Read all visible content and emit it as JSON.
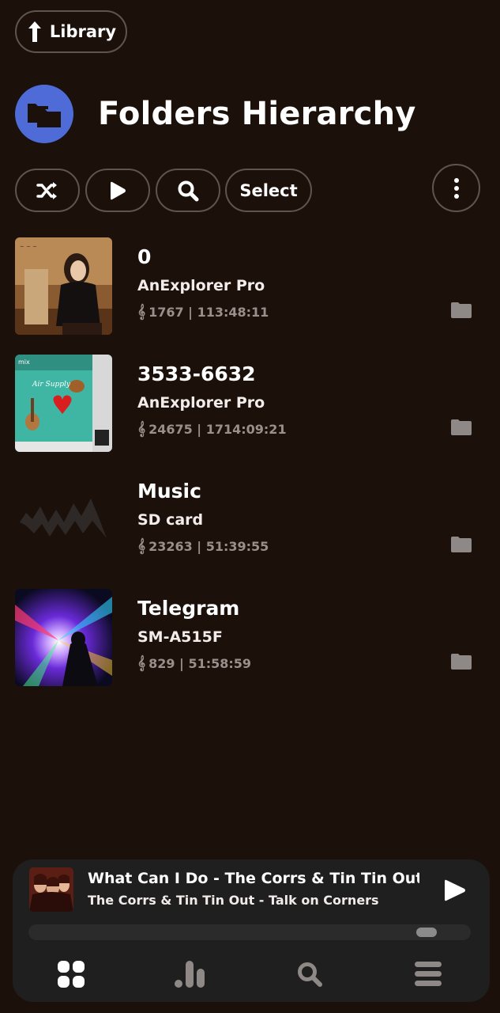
{
  "top_nav": {
    "library_label": "Library"
  },
  "header": {
    "title": "Folders Hierarchy"
  },
  "toolbar": {
    "select_label": "Select"
  },
  "folders": [
    {
      "name": "0",
      "source": "AnExplorer Pro",
      "meta": "1767 | 113:48:11",
      "thumb": "woman-portrait-art"
    },
    {
      "name": "3533-6632",
      "source": "AnExplorer Pro",
      "meta": "24675 | 1714:09:21",
      "thumb": "air-supply-album-art"
    },
    {
      "name": "Music",
      "source": "SD card",
      "meta": "23263 | 51:39:55",
      "thumb": "waveform-placeholder"
    },
    {
      "name": "Telegram",
      "source": "SM-A515F",
      "meta": "829 | 51:58:59",
      "thumb": "light-rays-art"
    }
  ],
  "now_playing": {
    "title": "What Can I Do - The Corrs & Tin Tin Out ( …",
    "artist_album": "The Corrs & Tin Tin Out - Talk on Corners",
    "progress": 0.92
  },
  "bottom_nav": {
    "items": [
      "grid-icon",
      "bar-chart-icon",
      "search-icon",
      "menu-icon"
    ]
  },
  "colors": {
    "background": "#1c100b",
    "accent_blue": "#4e6bd8",
    "meta_gray": "#9a8f8a",
    "player_bg": "#1f1f1f"
  }
}
